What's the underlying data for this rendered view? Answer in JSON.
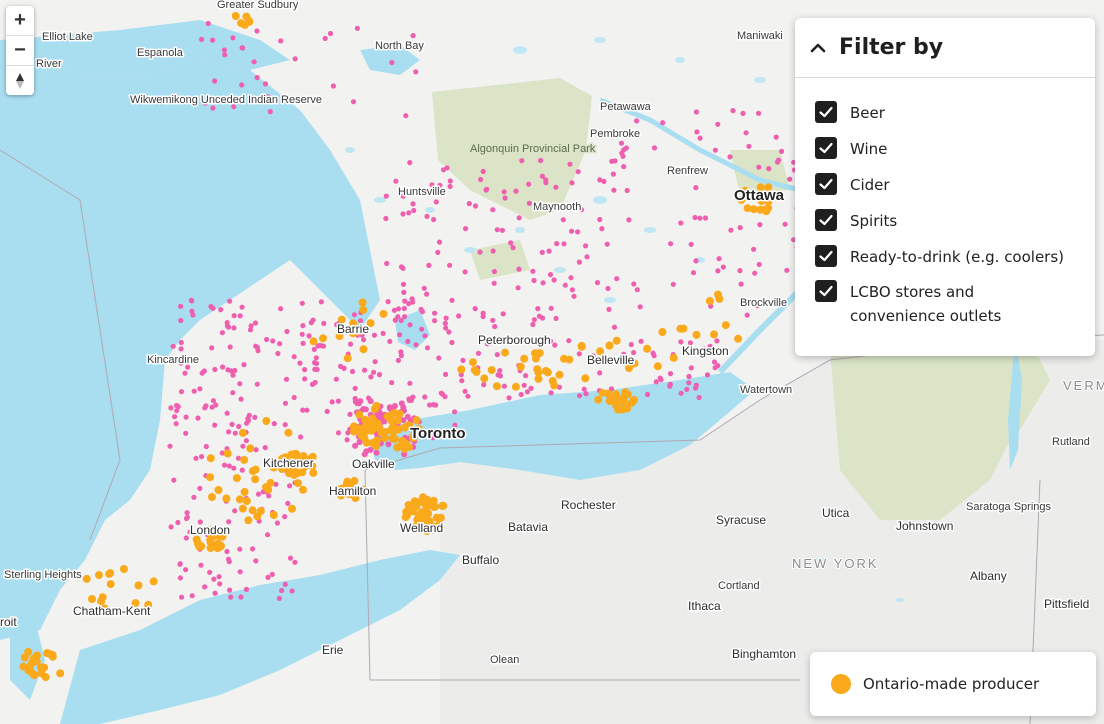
{
  "colors": {
    "water": "#a9def0",
    "land_ca": "#f2f2f0",
    "land_us": "#ececea",
    "park": "#dbe4c7",
    "producer": "#f9a91a",
    "retail": "#ef5fb0"
  },
  "zoom": {
    "in_label": "+",
    "out_label": "−",
    "compass_icon": "compass-icon"
  },
  "filter": {
    "title": "Filter by",
    "collapse_icon": "chevron-up-icon",
    "options": [
      {
        "label": "Beer",
        "checked": true
      },
      {
        "label": "Wine",
        "checked": true
      },
      {
        "label": "Cider",
        "checked": true
      },
      {
        "label": "Spirits",
        "checked": true
      },
      {
        "label": "Ready-to-drink (e.g. coolers)",
        "checked": true
      },
      {
        "label": "LCBO stores and convenience outlets",
        "checked": true
      }
    ]
  },
  "legend": {
    "label": "Ontario-made producer"
  },
  "places": {
    "greater_sudbury": "Greater Sudbury",
    "elliot_lake": "Elliot Lake",
    "espanola": "Espanola",
    "river": "River",
    "north_bay": "North Bay",
    "maniwaki": "Maniwaki",
    "wikwemikong": "Wikwemikong Unceded Indian Reserve",
    "algonquin": "Algonquin Provincial Park",
    "petawawa": "Petawawa",
    "pembroke": "Pembroke",
    "renfrew": "Renfrew",
    "ottawa": "Ottawa",
    "huntsville": "Huntsville",
    "maynooth": "Maynooth",
    "brockville": "Brockville",
    "barrie": "Barrie",
    "peterborough": "Peterborough",
    "belleville": "Belleville",
    "kingston": "Kingston",
    "kincardine": "Kincardine",
    "watertown": "Watertown",
    "vermont": "VERMO",
    "toronto": "Toronto",
    "rutland": "Rutland",
    "kitchener": "Kitchener",
    "oakville": "Oakville",
    "hamilton": "Hamilton",
    "rochester": "Rochester",
    "utica": "Utica",
    "johnstown": "Johnstown",
    "saratoga": "Saratoga Springs",
    "batavia": "Batavia",
    "syracuse": "Syracuse",
    "london": "London",
    "welland": "Welland",
    "buffalo": "Buffalo",
    "new_york": "NEW YORK",
    "sterling_heights": "Sterling Heights",
    "cortland": "Cortland",
    "albany": "Albany",
    "pittsfield": "Pittsfield",
    "chatham_kent": "Chatham-Kent",
    "ithaca": "Ithaca",
    "detroit": "roit",
    "erie": "Erie",
    "olean": "Olean",
    "binghamton": "Binghamton"
  }
}
